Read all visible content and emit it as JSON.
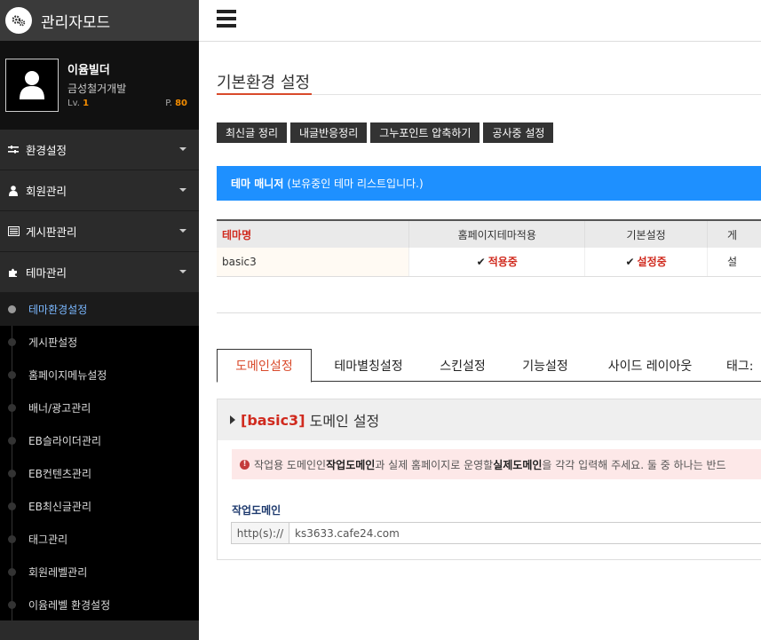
{
  "brand": {
    "title": "관리자모드",
    "icon": "gears-icon"
  },
  "profile": {
    "name": "이윰빌더",
    "org": "금성철거개발",
    "level_label": "Lv.",
    "level_value": "1",
    "point_label": "P.",
    "point_value": "80",
    "accent_color": "#f38c00"
  },
  "sidebar": {
    "sections": [
      {
        "label": "환경설정",
        "icon": "sliders-icon"
      },
      {
        "label": "회원관리",
        "icon": "user-icon"
      },
      {
        "label": "게시판관리",
        "icon": "board-icon"
      },
      {
        "label": "테마관리",
        "icon": "puzzle-icon"
      }
    ],
    "submenu": [
      {
        "label": "테마환경설정",
        "active": true
      },
      {
        "label": "게시판설정"
      },
      {
        "label": "홈페이지메뉴설정"
      },
      {
        "label": "배너/광고관리"
      },
      {
        "label": "EB슬라이더관리"
      },
      {
        "label": "EB컨텐츠관리"
      },
      {
        "label": "EB최신글관리"
      },
      {
        "label": "태그관리"
      },
      {
        "label": "회원레벨관리"
      },
      {
        "label": "이윰레벨 환경설정"
      }
    ]
  },
  "topbar": {
    "menu_icon": "hamburger-icon"
  },
  "page": {
    "title": "기본환경 설정",
    "accent_color": "#d94a2b"
  },
  "actions": [
    {
      "label": "최신글 정리"
    },
    {
      "label": "내글반응정리"
    },
    {
      "label": "그누포인트 압축하기"
    },
    {
      "label": "공사중 설정"
    }
  ],
  "theme_banner": {
    "title": "테마 매니저",
    "subtitle": "(보유중인 테마 리스트입니다.)",
    "color": "#1e90ff"
  },
  "theme_table": {
    "headers": [
      "테마명",
      "홈페이지테마적용",
      "기본설정",
      "게"
    ],
    "rows": [
      {
        "name": "basic3",
        "apply": "적용중",
        "basic": "설정중",
        "extra": "설"
      }
    ]
  },
  "tabs": [
    {
      "label": "도메인설정",
      "active": true
    },
    {
      "label": "테마별칭설정"
    },
    {
      "label": "스킨설정"
    },
    {
      "label": "기능설정"
    },
    {
      "label": "사이드 레이아웃"
    },
    {
      "label": "태그:"
    }
  ],
  "domain": {
    "heading_open": "[",
    "theme": "basic3",
    "heading_close": "]",
    "heading_text": "도메인 설정",
    "alert": {
      "p1": "작업용 도메인인 ",
      "b1": "작업도메인",
      "p2": "과 실제 홈페이지로 운영할 ",
      "b2": "실제도메인",
      "p3": "을 각각 입력해 주세요. 둘 중 하나는 반드"
    },
    "field_label": "작업도메인",
    "prefix": "http(s)://",
    "value": "ks3633.cafe24.com"
  }
}
